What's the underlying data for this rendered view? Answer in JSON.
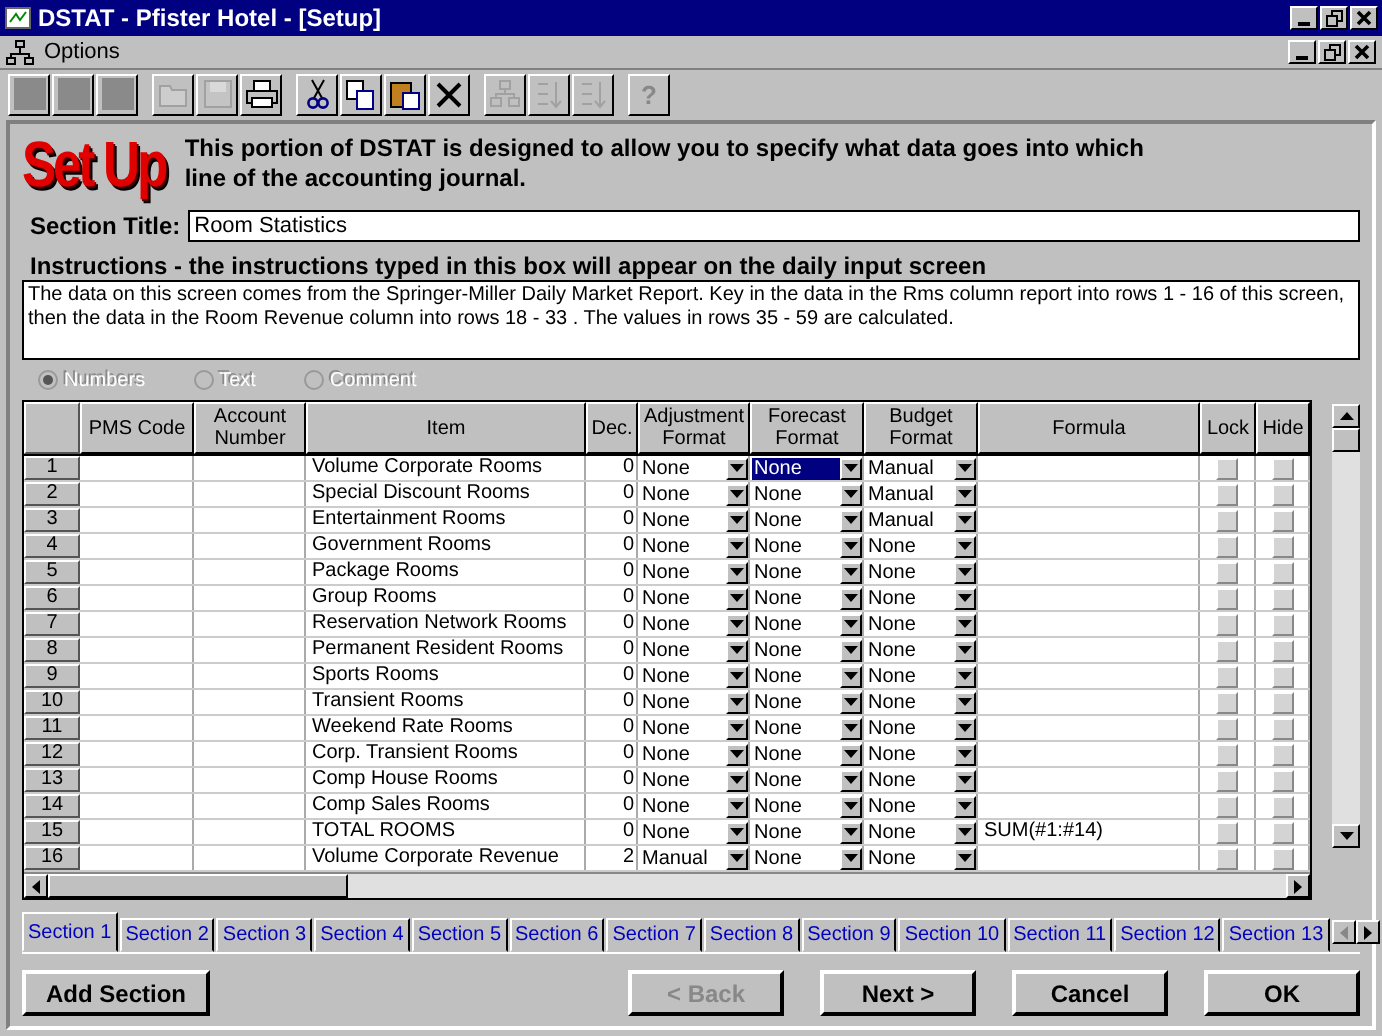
{
  "window": {
    "title": "DSTAT - Pfister Hotel - [Setup]"
  },
  "menu_bar": {
    "items": [
      "Options"
    ]
  },
  "toolbar": [
    {
      "kind": "blank",
      "disabled": false
    },
    {
      "kind": "blank",
      "disabled": false
    },
    {
      "kind": "blank",
      "disabled": false
    },
    {
      "kind": "open",
      "disabled": true
    },
    {
      "kind": "save",
      "disabled": true
    },
    {
      "kind": "print",
      "disabled": false
    },
    {
      "kind": "cut",
      "disabled": false
    },
    {
      "kind": "copy",
      "disabled": false
    },
    {
      "kind": "paste",
      "disabled": false
    },
    {
      "kind": "delete",
      "disabled": false
    },
    {
      "kind": "tree",
      "disabled": true
    },
    {
      "kind": "sort-asc",
      "disabled": true
    },
    {
      "kind": "sort-desc",
      "disabled": true
    },
    {
      "kind": "help",
      "label": "?",
      "disabled": true
    }
  ],
  "header": {
    "logo": "Set Up",
    "description": "This portion of DSTAT is designed to allow you to specify what data goes into which line of the accounting journal."
  },
  "section_title": {
    "label": "Section Title:",
    "value": "Room Statistics"
  },
  "instructions": {
    "label": "Instructions - the instructions typed in this box will appear on the daily input screen",
    "value": "The data on this screen comes from the Springer-Miller Daily Market Report.  Key in the data in the Rms column report into rows 1 - 16 of this screen, then the data in the Room Revenue column into rows 18 - 33 .  The values in rows 35 - 59 are calculated."
  },
  "row_type": [
    {
      "label": "Numbers",
      "selected": true,
      "disabled": true
    },
    {
      "label": "Text",
      "selected": false,
      "disabled": true
    },
    {
      "label": "Comment",
      "selected": false,
      "disabled": true
    }
  ],
  "table": {
    "columns": [
      "PMS Code",
      "Account Number",
      "Item",
      "Dec.",
      "Adjustment Format",
      "Forecast Format",
      "Budget Format",
      "Formula",
      "Lock",
      "Hide"
    ],
    "rows": [
      {
        "num": "1",
        "item": "Volume Corporate Rooms",
        "dec": "0",
        "adjustment": "None",
        "forecast": "None",
        "budget": "Manual",
        "formula": "",
        "forecast_selected": true,
        "lock": false,
        "hide": false
      },
      {
        "num": "2",
        "item": "Special Discount Rooms",
        "dec": "0",
        "adjustment": "None",
        "forecast": "None",
        "budget": "Manual",
        "formula": "",
        "forecast_selected": false,
        "lock": false,
        "hide": false
      },
      {
        "num": "3",
        "item": "Entertainment Rooms",
        "dec": "0",
        "adjustment": "None",
        "forecast": "None",
        "budget": "Manual",
        "formula": "",
        "forecast_selected": false,
        "lock": false,
        "hide": false
      },
      {
        "num": "4",
        "item": "Government Rooms",
        "dec": "0",
        "adjustment": "None",
        "forecast": "None",
        "budget": "None",
        "formula": "",
        "forecast_selected": false,
        "lock": false,
        "hide": false
      },
      {
        "num": "5",
        "item": "Package Rooms",
        "dec": "0",
        "adjustment": "None",
        "forecast": "None",
        "budget": "None",
        "formula": "",
        "forecast_selected": false,
        "lock": false,
        "hide": false
      },
      {
        "num": "6",
        "item": "Group Rooms",
        "dec": "0",
        "adjustment": "None",
        "forecast": "None",
        "budget": "None",
        "formula": "",
        "forecast_selected": false,
        "lock": false,
        "hide": false
      },
      {
        "num": "7",
        "item": "Reservation Network Rooms",
        "dec": "0",
        "adjustment": "None",
        "forecast": "None",
        "budget": "None",
        "formula": "",
        "forecast_selected": false,
        "lock": false,
        "hide": false
      },
      {
        "num": "8",
        "item": "Permanent Resident Rooms",
        "dec": "0",
        "adjustment": "None",
        "forecast": "None",
        "budget": "None",
        "formula": "",
        "forecast_selected": false,
        "lock": false,
        "hide": false
      },
      {
        "num": "9",
        "item": "Sports Rooms",
        "dec": "0",
        "adjustment": "None",
        "forecast": "None",
        "budget": "None",
        "formula": "",
        "forecast_selected": false,
        "lock": false,
        "hide": false
      },
      {
        "num": "10",
        "item": "Transient Rooms",
        "dec": "0",
        "adjustment": "None",
        "forecast": "None",
        "budget": "None",
        "formula": "",
        "forecast_selected": false,
        "lock": false,
        "hide": false
      },
      {
        "num": "11",
        "item": "Weekend Rate Rooms",
        "dec": "0",
        "adjustment": "None",
        "forecast": "None",
        "budget": "None",
        "formula": "",
        "forecast_selected": false,
        "lock": false,
        "hide": false
      },
      {
        "num": "12",
        "item": "Corp. Transient Rooms",
        "dec": "0",
        "adjustment": "None",
        "forecast": "None",
        "budget": "None",
        "formula": "",
        "forecast_selected": false,
        "lock": false,
        "hide": false
      },
      {
        "num": "13",
        "item": "Comp House Rooms",
        "dec": "0",
        "adjustment": "None",
        "forecast": "None",
        "budget": "None",
        "formula": "",
        "forecast_selected": false,
        "lock": false,
        "hide": false
      },
      {
        "num": "14",
        "item": "Comp Sales Rooms",
        "dec": "0",
        "adjustment": "None",
        "forecast": "None",
        "budget": "None",
        "formula": "",
        "forecast_selected": false,
        "lock": false,
        "hide": false
      },
      {
        "num": "15",
        "item": "TOTAL ROOMS",
        "dec": "0",
        "adjustment": "None",
        "forecast": "None",
        "budget": "None",
        "formula": "SUM(#1:#14)",
        "forecast_selected": false,
        "lock": false,
        "hide": false
      },
      {
        "num": "16",
        "item": "Volume Corporate Revenue",
        "dec": "2",
        "adjustment": "Manual",
        "forecast": "None",
        "budget": "None",
        "formula": "",
        "forecast_selected": false,
        "lock": false,
        "hide": false
      }
    ]
  },
  "tabs": [
    {
      "label": "Section 1",
      "selected": true
    },
    {
      "label": "Section 2",
      "selected": false
    },
    {
      "label": "Section 3",
      "selected": false
    },
    {
      "label": "Section 4",
      "selected": false
    },
    {
      "label": "Section 5",
      "selected": false
    },
    {
      "label": "Section 6",
      "selected": false
    },
    {
      "label": "Section 7",
      "selected": false
    },
    {
      "label": "Section 8",
      "selected": false
    },
    {
      "label": "Section 9",
      "selected": false
    },
    {
      "label": "Section 10",
      "selected": false
    },
    {
      "label": "Section 11",
      "selected": false
    },
    {
      "label": "Section 12",
      "selected": false
    },
    {
      "label": "Section 13",
      "selected": false
    }
  ],
  "buttons": [
    {
      "label": "Add Section",
      "kind": "left",
      "disabled": false
    },
    {
      "label": "< Back",
      "kind": "right",
      "disabled": true
    },
    {
      "label": "Next >",
      "kind": "right",
      "disabled": false
    },
    {
      "label": "Cancel",
      "kind": "right",
      "disabled": false
    },
    {
      "label": "OK",
      "kind": "right",
      "disabled": false
    }
  ]
}
